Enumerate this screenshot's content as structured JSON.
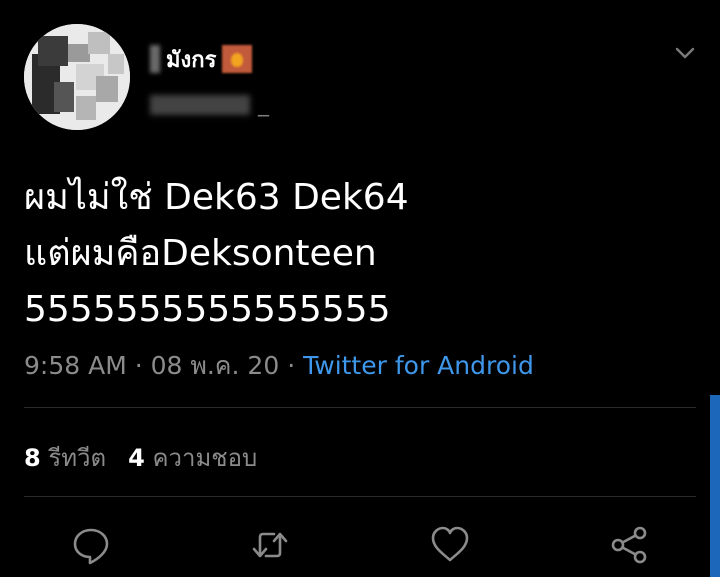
{
  "tweet": {
    "display_name": "มังกร",
    "handle": "_",
    "text_lines": [
      "ผมไม่ใช่ Dek63 Dek64",
      "แต่ผมคือDeksonteen",
      "5555555555555555"
    ],
    "time": "9:58 AM",
    "date": "08 พ.ค. 20",
    "separator": "·",
    "source": "Twitter for Android",
    "stats": {
      "retweet_count": "8",
      "retweet_label": "รีทวีต",
      "like_count": "4",
      "like_label": "ความชอบ"
    }
  },
  "icons": {
    "more": "chevron-down-icon",
    "reply": "reply-icon",
    "retweet": "retweet-icon",
    "like": "heart-icon",
    "share": "share-icon"
  },
  "colors": {
    "background": "#000000",
    "link": "#3e97ea",
    "secondary_text": "#8b8b8b"
  }
}
